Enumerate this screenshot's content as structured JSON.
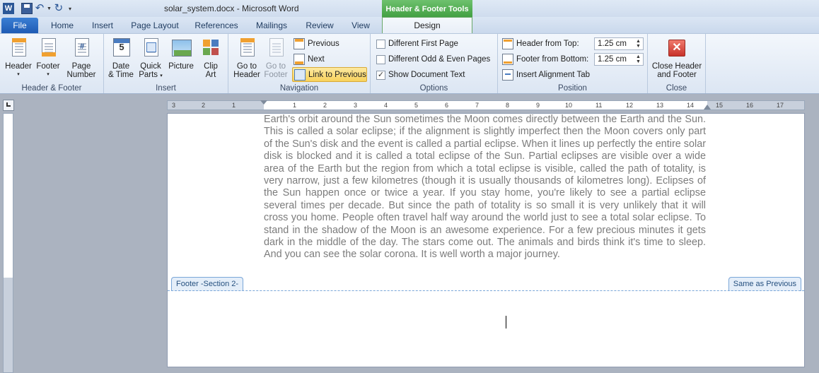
{
  "window": {
    "title": "solar_system.docx - Microsoft Word",
    "context_tools": "Header & Footer Tools"
  },
  "tabs": [
    "File",
    "Home",
    "Insert",
    "Page Layout",
    "References",
    "Mailings",
    "Review",
    "View",
    "Design"
  ],
  "ribbon": {
    "header_footer": {
      "label": "Header & Footer",
      "header": "Header",
      "footer": "Footer",
      "page_number_1": "Page",
      "page_number_2": "Number"
    },
    "insert": {
      "label": "Insert",
      "date_1": "Date",
      "date_2": "& Time",
      "quick_1": "Quick",
      "quick_2": "Parts",
      "picture": "Picture",
      "clip_1": "Clip",
      "clip_2": "Art"
    },
    "navigation": {
      "label": "Navigation",
      "goto_header_1": "Go to",
      "goto_header_2": "Header",
      "goto_footer_1": "Go to",
      "goto_footer_2": "Footer",
      "previous": "Previous",
      "next": "Next",
      "link_previous": "Link to Previous"
    },
    "options": {
      "label": "Options",
      "different_first": "Different First Page",
      "different_odd_even": "Different Odd & Even Pages",
      "show_doc_text": "Show Document Text",
      "show_doc_text_checked": true
    },
    "position": {
      "label": "Position",
      "header_from_top": "Header from Top:",
      "header_value": "1.25 cm",
      "footer_from_bottom": "Footer from Bottom:",
      "footer_value": "1.25 cm",
      "insert_alignment_tab": "Insert Alignment Tab"
    },
    "close": {
      "label": "Close",
      "close_1": "Close Header",
      "close_2": "and Footer"
    }
  },
  "ruler": {
    "ticks": [
      "3",
      "2",
      "1",
      "1",
      "2",
      "3",
      "4",
      "5",
      "6",
      "7",
      "8",
      "9",
      "10",
      "11",
      "12",
      "13",
      "14",
      "15",
      "16",
      "17"
    ]
  },
  "document": {
    "body_text": "Earth's orbit around the Sun sometimes the Moon comes directly between the Earth and the Sun. This is called a solar eclipse; if the alignment is slightly imperfect then the Moon covers only part of the Sun's disk and the event is called a partial eclipse. When it lines up perfectly the entire solar disk is blocked and it is called a total eclipse of the Sun. Partial eclipses are visible over a wide area of the Earth but the region from which a total eclipse is visible, called the path of totality, is very narrow, just a few kilometres (though it is usually thousands of kilometres long). Eclipses of the Sun happen once or twice a year. If you stay home, you're likely to see a partial eclipse several times per decade. But since the path of totality is so small it is very unlikely that it will cross you home. People often travel half way around the world just to see a total solar eclipse. To stand in the shadow of the Moon is an awesome experience. For a few precious minutes it gets dark in the middle of the day. The stars come out. The animals and birds think it's time to sleep. And you can see the solar corona. It is well worth a major journey.",
    "footer_label": "Footer -Section 2-",
    "same_as_previous": "Same as Previous"
  }
}
